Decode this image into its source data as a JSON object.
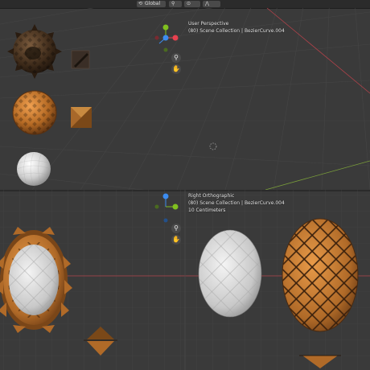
{
  "toolbar": {
    "transform_orientation": "Global",
    "orientation_icon": "orientation-gizmo-icon",
    "snap_icon": "snap-icon",
    "proportional_icon": "proportional-edit-icon"
  },
  "top_viewport": {
    "view_name": "User Perspective",
    "collection_info": "(80) Scene Collection | BezierCurve.004",
    "gizmo_labels": {
      "z": "Z",
      "x": "X",
      "y": "Y"
    }
  },
  "bottom_viewport": {
    "view_name": "Right Orthographic",
    "collection_info": "(80) Scene Collection | BezierCurve.004",
    "scale_info": "10 Centimeters",
    "gizmo_labels": {
      "z": "Z",
      "y": "Y"
    }
  },
  "nav_icons": {
    "zoom": "zoom-icon",
    "pan": "hand-pan-icon"
  },
  "colors": {
    "background": "#3a3a3a",
    "grid_line": "#454545",
    "axis_red": "#b0424a",
    "axis_green": "#7a9e3a",
    "gizmo_x": "#e8414f",
    "gizmo_y": "#80c01f",
    "gizmo_z": "#3c8cf0",
    "bronze": "#c07a32",
    "dark_bronze": "#5a3a1c",
    "silver": "#d4d4d4"
  }
}
